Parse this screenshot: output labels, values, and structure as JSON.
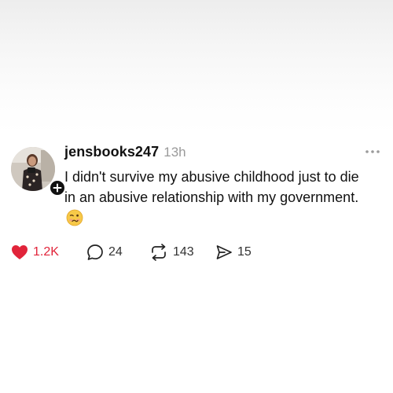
{
  "post": {
    "username": "jensbooks247",
    "timestamp": "13h",
    "text": "I didn't survive my abusive childhood just to die in an abusive relationship with my government.",
    "emoji_icon": "woozy-face-icon"
  },
  "actions": {
    "likes": "1.2K",
    "replies": "24",
    "reposts": "143",
    "shares": "15"
  },
  "colors": {
    "like": "#e1243a",
    "text": "#111111",
    "muted": "#9a9a9a"
  }
}
